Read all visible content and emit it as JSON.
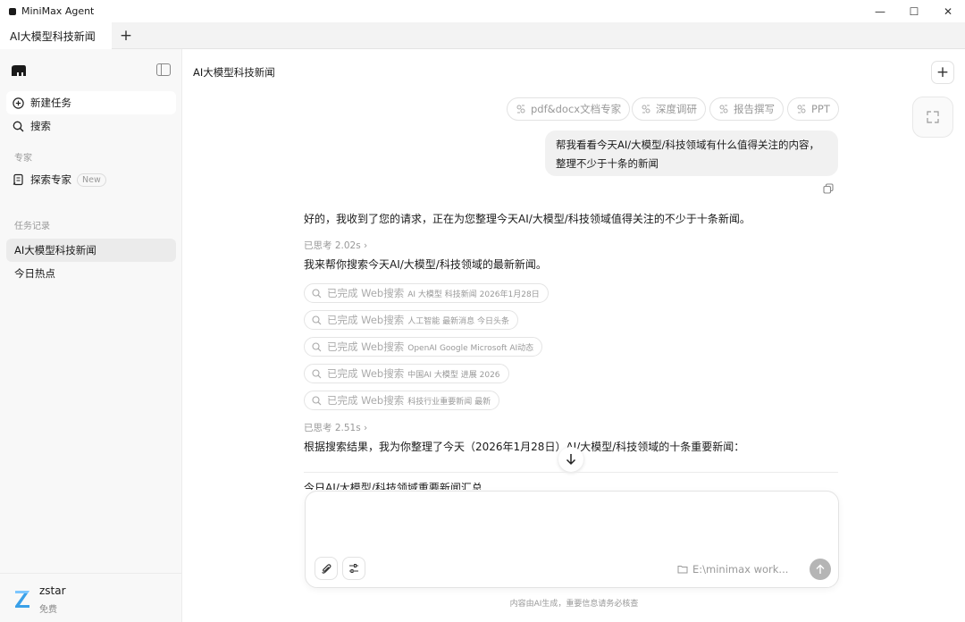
{
  "window": {
    "title": "MiniMax Agent",
    "minimize": "—",
    "maximize": "☐",
    "close": "✕"
  },
  "tabs": [
    {
      "label": "AI大模型科技新闻"
    }
  ],
  "tab_add": "+",
  "sidebar": {
    "new_task": "新建任务",
    "search": "搜索",
    "experts_label": "专家",
    "explore_expert": "探索专家",
    "new_badge": "New",
    "history_label": "任务记录",
    "history": [
      "AI大模型科技新闻",
      "今日热点"
    ]
  },
  "user": {
    "name": "zstar",
    "plan": "免费"
  },
  "main": {
    "title": "AI大模型科技新闻",
    "new_button": "+",
    "chips": [
      "pdf&docx文档专家",
      "深度调研",
      "报告撰写",
      "PPT"
    ],
    "user_message": "帮我看看今天AI/大模型/科技领域有什么值得关注的内容，整理不少于十条的新闻",
    "ai_intro": "好的，我收到了您的请求，正在为您整理今天AI/大模型/科技领域值得关注的不少于十条新闻。",
    "thought1": "已思考 2.02s ›",
    "ai_search_text": "我来帮你搜索今天AI/大模型/科技领域的最新新闻。",
    "searches": [
      {
        "label": "已完成 Web搜索",
        "query": "AI 大模型 科技新闻 2026年1月28日"
      },
      {
        "label": "已完成 Web搜索",
        "query": "人工智能 最新消息 今日头条"
      },
      {
        "label": "已完成 Web搜索",
        "query": "OpenAI Google Microsoft AI动态"
      },
      {
        "label": "已完成 Web搜索",
        "query": "中国AI 大模型 进展 2026"
      },
      {
        "label": "已完成 Web搜索",
        "query": "科技行业重要新闻 最新"
      }
    ],
    "thought2": "已思考 2.51s ›",
    "ai_result_text": "根据搜索结果，我为你整理了今天（2026年1月28日）AI/大模型/科技领域的十条重要新闻：",
    "partial_heading": "今日AI/大模型/科技领域重要新闻汇总"
  },
  "composer": {
    "workspace": "E:\\minimax work...",
    "footnote": "内容由AI生成，重要信息请务必核查"
  }
}
